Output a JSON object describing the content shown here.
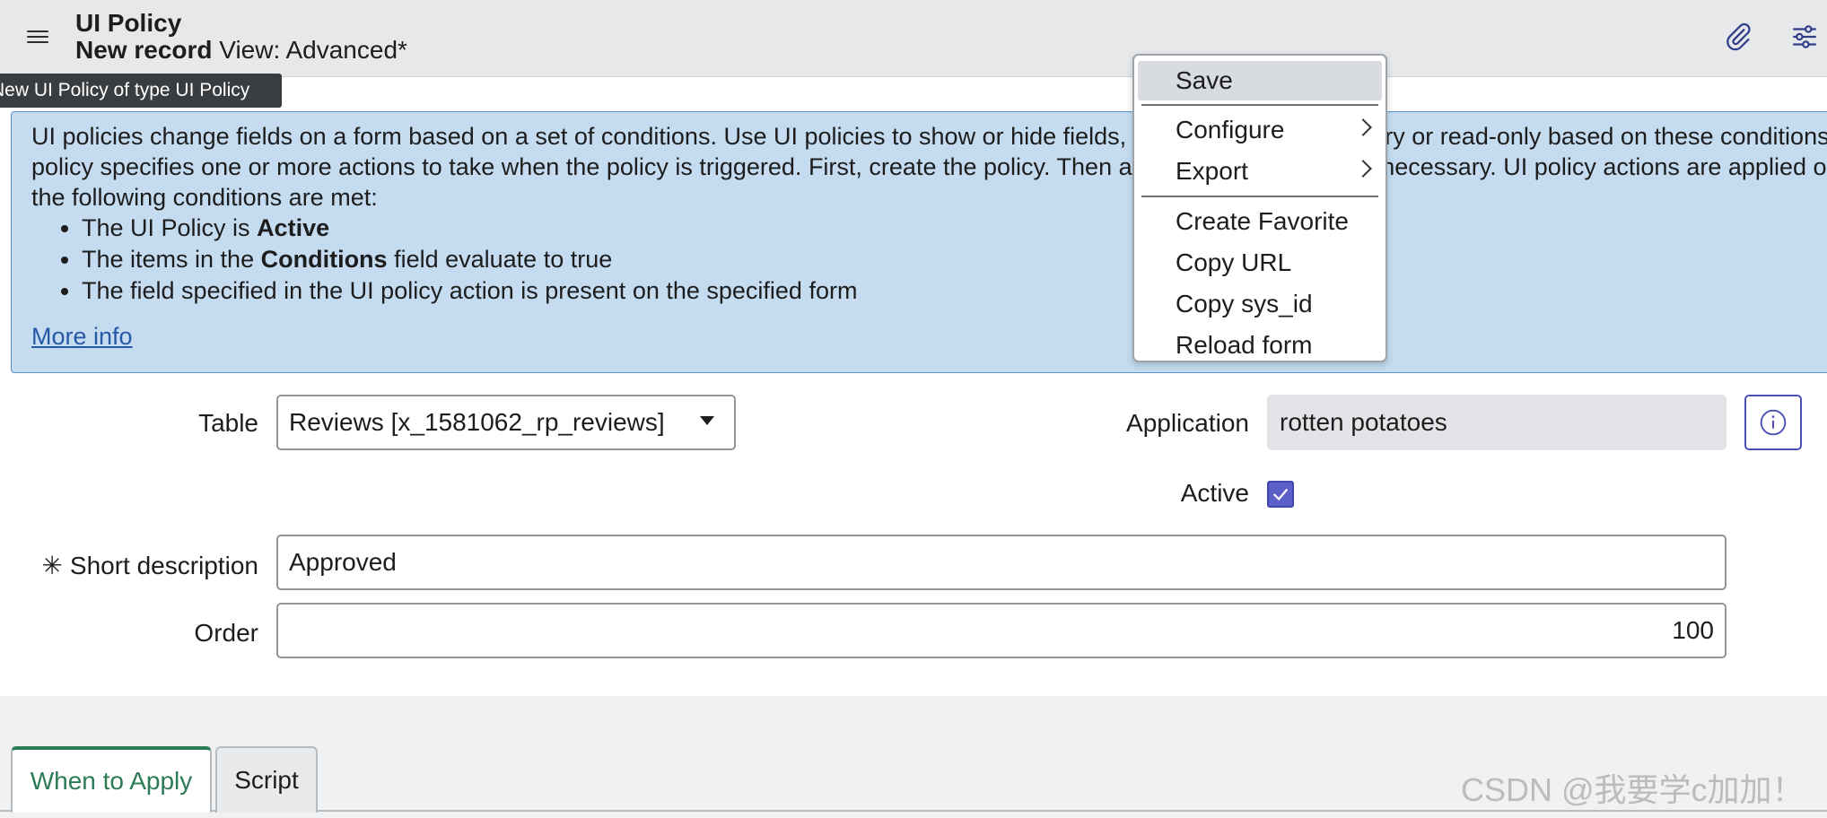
{
  "header": {
    "title": "UI Policy",
    "record_label": "New record",
    "view_label": "View: Advanced*"
  },
  "tooltip": "New UI Policy of type UI Policy",
  "info": {
    "line1": "UI policies change fields on a form based on a set of conditions. Use UI policies to show or hide fields, or make fields mandatory or read-only based on these conditions. Each",
    "line2": "policy specifies one or more actions to take when the policy is triggered. First, create the policy. Then add UI policy actions as necessary. UI policy actions are applied only if",
    "line3": "the following conditions are met:",
    "bullets": [
      {
        "pre": "The UI Policy is ",
        "bold": "Active",
        "post": ""
      },
      {
        "pre": "The items in the ",
        "bold": "Conditions",
        "post": " field evaluate to true"
      },
      {
        "pre": "The field specified in the UI policy action is present on the specified form",
        "bold": "",
        "post": ""
      }
    ],
    "more_info": "More info"
  },
  "form": {
    "table_label": "Table",
    "table_value": "Reviews [x_1581062_rp_reviews]",
    "application_label": "Application",
    "application_value": "rotten potatoes",
    "active_label": "Active",
    "active_checked": true,
    "short_description_label": "Short description",
    "required_marker": "✳",
    "short_description_value": "Approved",
    "order_label": "Order",
    "order_value": "100"
  },
  "tabs": [
    {
      "label": "When to Apply",
      "active": true
    },
    {
      "label": "Script",
      "active": false
    }
  ],
  "context_menu": {
    "items": [
      {
        "label": "Save",
        "highlighted": true
      },
      {
        "label": "Configure",
        "submenu": true
      },
      {
        "label": "Export",
        "submenu": true
      },
      {
        "label": "Create Favorite"
      },
      {
        "label": "Copy URL"
      },
      {
        "label": "Copy sys_id"
      },
      {
        "label": "Reload form"
      }
    ]
  },
  "watermark": "CSDN @我要学c加加！",
  "colors": {
    "header_bg": "#e6e8ea",
    "info_bg": "#c4dbf0",
    "info_border": "#5a92c9",
    "accent_green": "#2d7a56",
    "checkbox": "#5b5fc7",
    "link": "#2758a6"
  },
  "icons": {
    "menu": "hamburger-icon",
    "attachment": "paperclip-icon",
    "settings": "sliders-icon",
    "info": "info-circle-icon",
    "check": "checkmark-icon"
  }
}
